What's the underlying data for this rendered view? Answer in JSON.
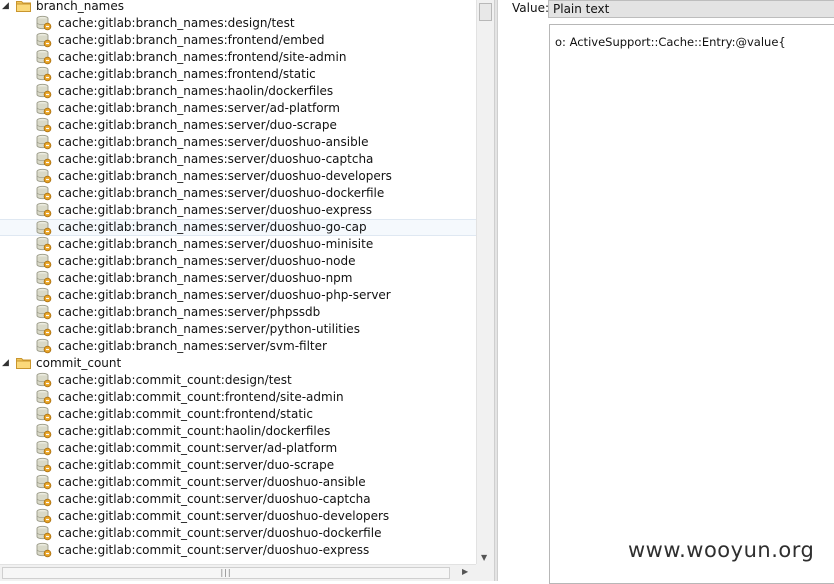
{
  "tree": {
    "groups": [
      {
        "name": "branch_names",
        "expanded": true,
        "keys": [
          "cache:gitlab:branch_names:design/test",
          "cache:gitlab:branch_names:frontend/embed",
          "cache:gitlab:branch_names:frontend/site-admin",
          "cache:gitlab:branch_names:frontend/static",
          "cache:gitlab:branch_names:haolin/dockerfiles",
          "cache:gitlab:branch_names:server/ad-platform",
          "cache:gitlab:branch_names:server/duo-scrape",
          "cache:gitlab:branch_names:server/duoshuo-ansible",
          "cache:gitlab:branch_names:server/duoshuo-captcha",
          "cache:gitlab:branch_names:server/duoshuo-developers",
          "cache:gitlab:branch_names:server/duoshuo-dockerfile",
          "cache:gitlab:branch_names:server/duoshuo-express",
          "cache:gitlab:branch_names:server/duoshuo-go-cap",
          "cache:gitlab:branch_names:server/duoshuo-minisite",
          "cache:gitlab:branch_names:server/duoshuo-node",
          "cache:gitlab:branch_names:server/duoshuo-npm",
          "cache:gitlab:branch_names:server/duoshuo-php-server",
          "cache:gitlab:branch_names:server/phpssdb",
          "cache:gitlab:branch_names:server/python-utilities",
          "cache:gitlab:branch_names:server/svm-filter"
        ]
      },
      {
        "name": "commit_count",
        "expanded": true,
        "keys": [
          "cache:gitlab:commit_count:design/test",
          "cache:gitlab:commit_count:frontend/site-admin",
          "cache:gitlab:commit_count:frontend/static",
          "cache:gitlab:commit_count:haolin/dockerfiles",
          "cache:gitlab:commit_count:server/ad-platform",
          "cache:gitlab:commit_count:server/duo-scrape",
          "cache:gitlab:commit_count:server/duoshuo-ansible",
          "cache:gitlab:commit_count:server/duoshuo-captcha",
          "cache:gitlab:commit_count:server/duoshuo-developers",
          "cache:gitlab:commit_count:server/duoshuo-dockerfile",
          "cache:gitlab:commit_count:server/duoshuo-express"
        ]
      }
    ],
    "selected_key": "cache:gitlab:branch_names:server/duoshuo-go-cap"
  },
  "value_panel": {
    "label": "Value:",
    "format": "Plain text",
    "content": "o: ActiveSupport::Cache::Entry:@value{"
  },
  "watermark": "www.wooyun.org",
  "icons": {
    "folder": "folder-icon",
    "key": "database-key-icon",
    "expanded": "expanded-arrow-icon"
  },
  "colors": {
    "folder": "#f0c55a",
    "db_icon": "#d9d9c8",
    "key_badge": "#e8a427",
    "selection": "#f5f9fd"
  }
}
